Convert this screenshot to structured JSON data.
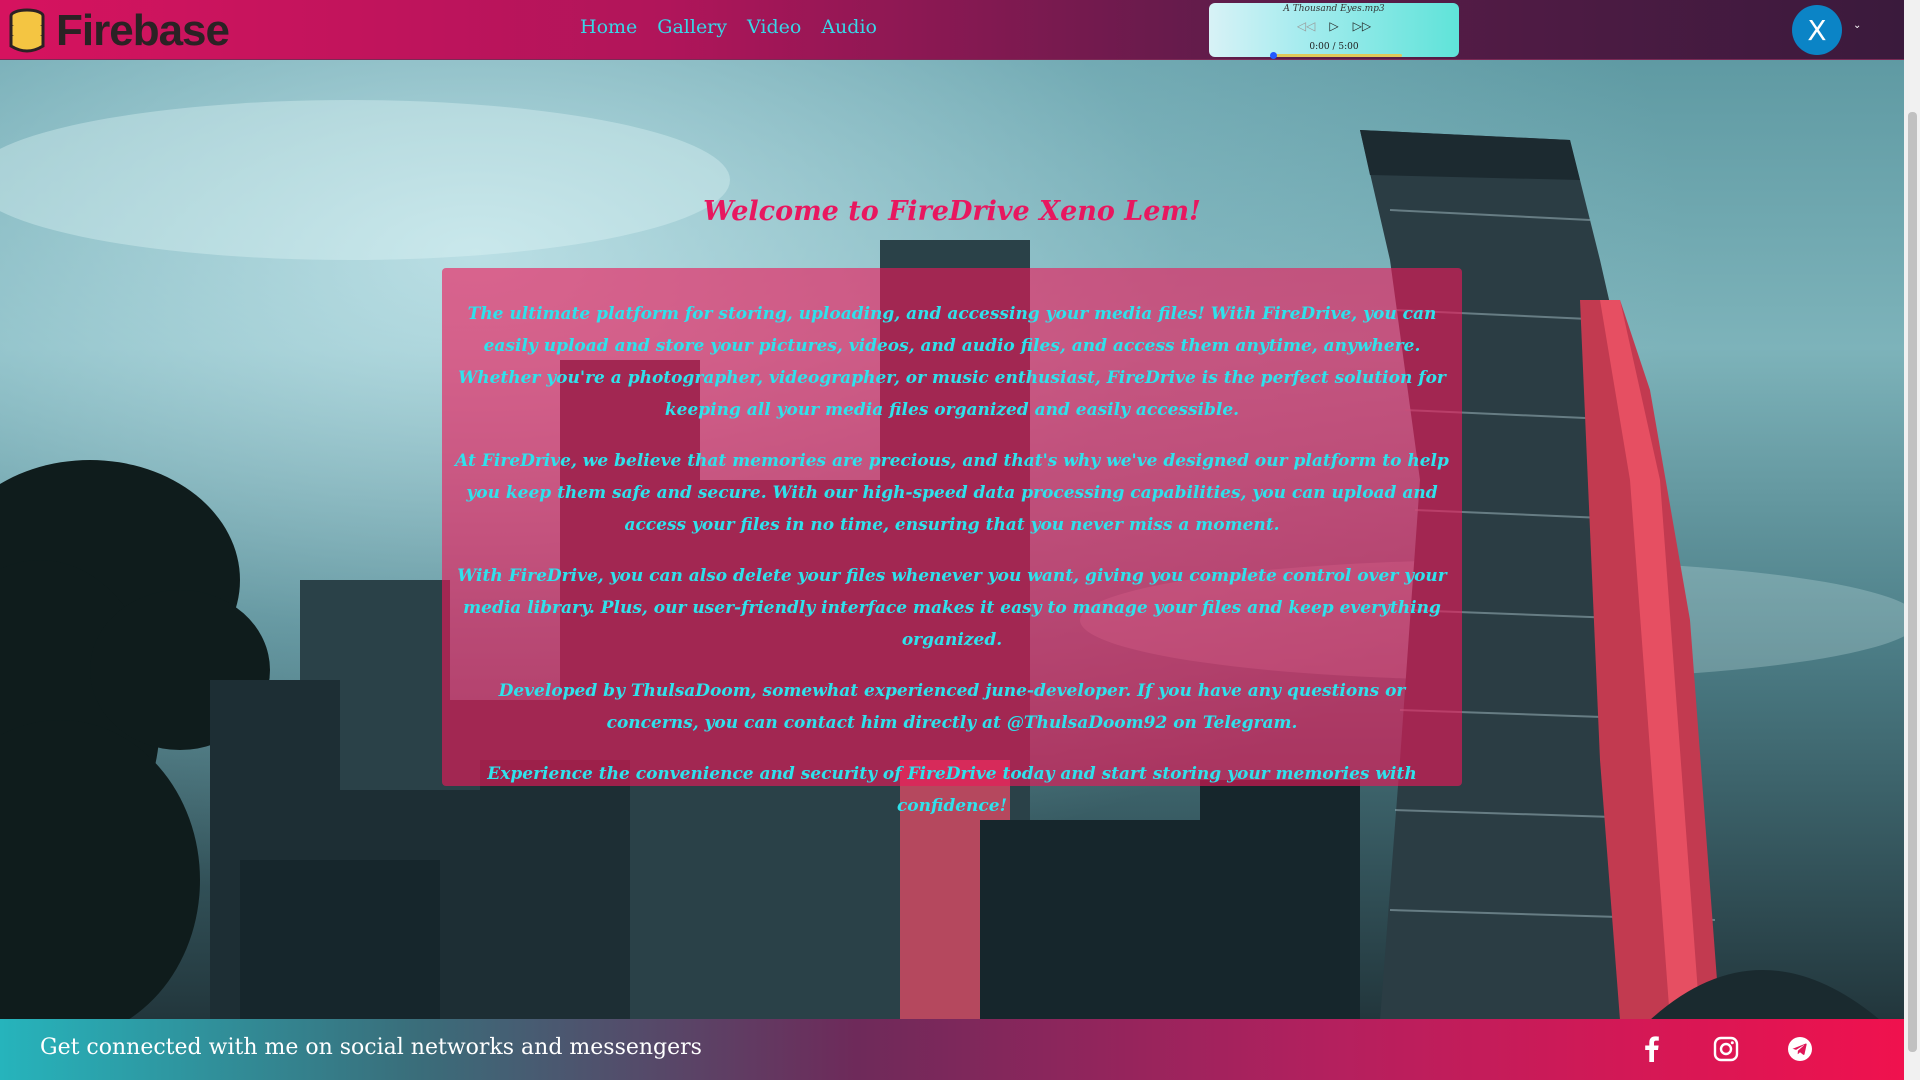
{
  "brand": {
    "name": "Firebase",
    "icon": "database-icon"
  },
  "nav": {
    "items": [
      {
        "label": "Home"
      },
      {
        "label": "Gallery"
      },
      {
        "label": "Video"
      },
      {
        "label": "Audio"
      }
    ]
  },
  "player": {
    "track": "A Thousand Eyes.mp3",
    "time": "0:00 / 5:00",
    "progress": 0.0,
    "icons": {
      "prev": "rewind-icon",
      "play": "play-icon",
      "next": "fast-forward-icon"
    }
  },
  "user": {
    "initial": "X",
    "menu_icon": "chevron-down-icon"
  },
  "main": {
    "title": "Welcome to FireDrive Xeno Lem!",
    "paragraphs": [
      "The ultimate platform for storing, uploading, and accessing your media files! With FireDrive, you can easily upload and store your pictures, videos, and audio files, and access them anytime, anywhere. Whether you're a photographer, videographer, or music enthusiast, FireDrive is the perfect solution for keeping all your media files organized and easily accessible.",
      "At FireDrive, we believe that memories are precious, and that's why we've designed our platform to help you keep them safe and secure. With our high-speed data processing capabilities, you can upload and access your files in no time, ensuring that you never miss a moment.",
      "With FireDrive, you can also delete your files whenever you want, giving you complete control over your media library. Plus, our user-friendly interface makes it easy to manage your files and keep everything organized.",
      "Developed by ThulsaDoom, somewhat experienced june-developer. If you have any questions or concerns, you can contact him directly at @ThulsaDoom92 on Telegram.",
      "Experience the convenience and security of FireDrive today and start storing your memories with confidence!"
    ]
  },
  "footer": {
    "text": "Get connected with me on social networks and messengers",
    "social": [
      {
        "icon": "facebook-icon"
      },
      {
        "icon": "instagram-icon"
      },
      {
        "icon": "telegram-icon"
      }
    ]
  },
  "colors": {
    "accent_pink": "#e8175f",
    "text_cyan": "#2fe2ec",
    "nav_cyan": "#37d7e8",
    "avatar_blue": "#0b84c6"
  }
}
